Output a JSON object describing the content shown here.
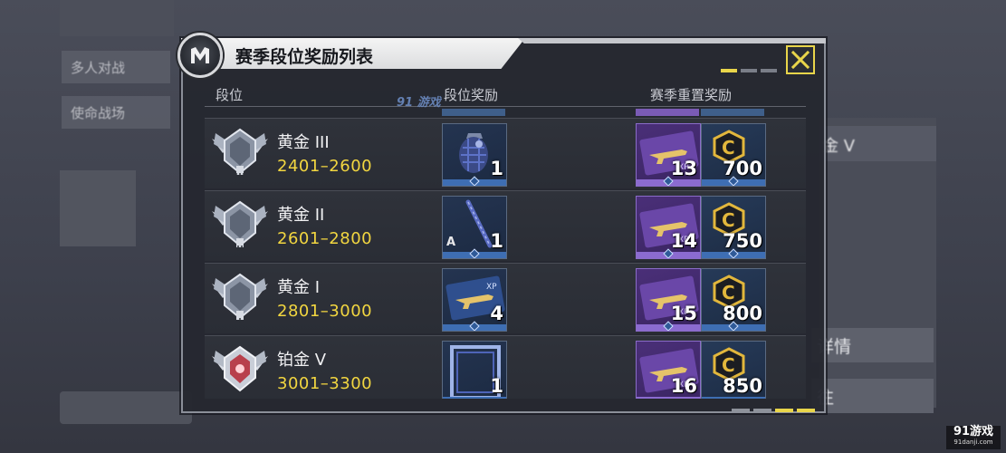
{
  "background": {
    "menu_items": [
      "多人对战",
      "使命战场"
    ],
    "right_labels": [
      "金 V",
      "详情",
      "往"
    ]
  },
  "dialog": {
    "title": "赛季段位奖励列表",
    "close_icon": "close-x-icon",
    "columns": {
      "rank": "段位",
      "rank_reward": "段位奖励",
      "season_reset_reward": "赛季重置奖励"
    },
    "rows": [
      {
        "rank_name": "黄金 III",
        "range": "2401–2600",
        "badge_color": "#9aa3b3",
        "rank_reward": {
          "item": "grenade",
          "count": "1"
        },
        "reset_rewards": [
          {
            "item": "weapon-xp-card",
            "count": "13"
          },
          {
            "item": "c-coin",
            "count": "700"
          }
        ]
      },
      {
        "rank_name": "黄金 II",
        "range": "2601–2800",
        "badge_color": "#9aa3b3",
        "rank_reward": {
          "item": "weapon-charm",
          "count": "1",
          "tag": "A"
        },
        "reset_rewards": [
          {
            "item": "weapon-xp-card",
            "count": "14"
          },
          {
            "item": "c-coin",
            "count": "750"
          }
        ]
      },
      {
        "rank_name": "黄金 I",
        "range": "2801–3000",
        "badge_color": "#9aa3b3",
        "rank_reward": {
          "item": "weapon-xp-card-blue",
          "count": "4"
        },
        "reset_rewards": [
          {
            "item": "weapon-xp-card",
            "count": "15"
          },
          {
            "item": "c-coin",
            "count": "800"
          }
        ]
      },
      {
        "rank_name": "铂金 V",
        "range": "3001–3300",
        "badge_color": "#b8404c",
        "rank_reward": {
          "item": "frame",
          "count": "1"
        },
        "reset_rewards": [
          {
            "item": "weapon-xp-card",
            "count": "16"
          },
          {
            "item": "c-coin",
            "count": "850"
          }
        ]
      }
    ]
  },
  "watermarks": {
    "top": "91 游戏",
    "corner_main": "91游戏",
    "corner_sub": "91danji.com"
  },
  "colors": {
    "accent_yellow": "#e9d54a",
    "range_text": "#f2d640",
    "xp_purple": "#8b6bd0",
    "item_blue": "#3e6eb3"
  }
}
